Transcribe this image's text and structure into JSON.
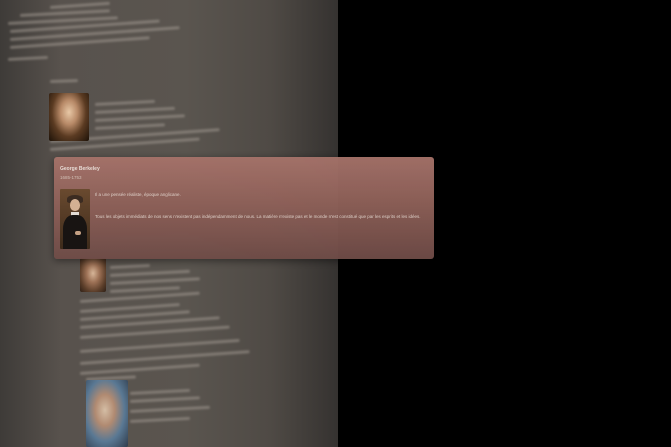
{
  "popup": {
    "name": "George Berkeley",
    "dates": "1685-1753",
    "description": "Il a une pensée réaliste, époque anglicane.",
    "quote": "Tous les objets immédiats de nos sens n'existent pas indépendamment de nous. La matière n'existe pas et le monde n'est constitué que par les esprits et les idées."
  },
  "icons": {
    "popup_portrait": "berkeley-portrait-icon",
    "background_portraits": [
      "philosopher-portrait-1-icon",
      "philosopher-portrait-2-icon",
      "philosopher-portrait-3-icon"
    ]
  },
  "colors": {
    "background": "#000000",
    "page": "#5a554f",
    "popup_top": "#a6736a",
    "popup_bottom": "#6f4c47"
  }
}
